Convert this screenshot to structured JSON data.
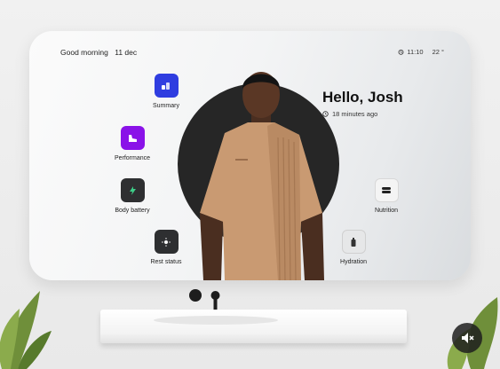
{
  "header": {
    "greeting": "Good morning",
    "date": "11 dec",
    "time": "11:10",
    "temperature": "22 °"
  },
  "profile": {
    "hello": "Hello, Josh",
    "last_seen": "18 minutes ago"
  },
  "widgets": {
    "summary": {
      "label": "Summary",
      "icon": "summary-icon",
      "color": "#2f3de0"
    },
    "performance": {
      "label": "Performance",
      "icon": "shoe-icon",
      "color": "#8a12e8"
    },
    "body_battery": {
      "label": "Body battery",
      "icon": "battery-icon",
      "color": "#2e2f31"
    },
    "rest_status": {
      "label": "Rest status",
      "icon": "sun-icon",
      "color": "#2e2f31"
    },
    "nutrition": {
      "label": "Nutrition",
      "icon": "food-icon",
      "color": "#f4f4f4"
    },
    "hydration": {
      "label": "Hydration",
      "icon": "bottle-icon",
      "color": "#e6e7e8"
    }
  },
  "overlay": {
    "mute_icon": "muted-speaker-icon"
  }
}
